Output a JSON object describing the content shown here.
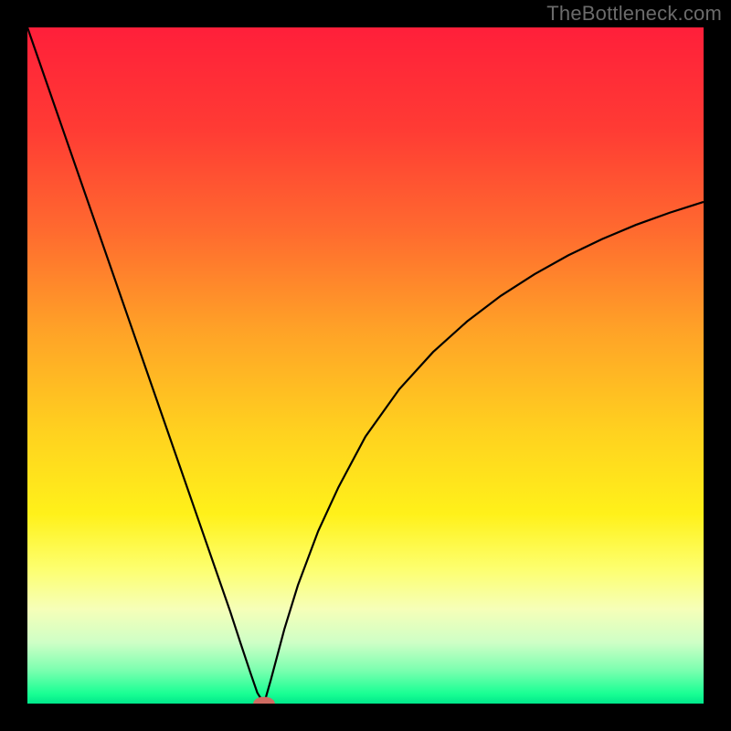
{
  "watermark": "TheBottleneck.com",
  "chart_data": {
    "type": "line",
    "title": "",
    "xlabel": "",
    "ylabel": "",
    "xlim": [
      0,
      100
    ],
    "ylim": [
      0,
      100
    ],
    "background_gradient": {
      "stops": [
        {
          "offset": 0.0,
          "color": "#ff1f3a"
        },
        {
          "offset": 0.15,
          "color": "#ff3b34"
        },
        {
          "offset": 0.3,
          "color": "#ff6a2f"
        },
        {
          "offset": 0.45,
          "color": "#ffa327"
        },
        {
          "offset": 0.6,
          "color": "#ffd21f"
        },
        {
          "offset": 0.72,
          "color": "#fff11a"
        },
        {
          "offset": 0.8,
          "color": "#fdff6e"
        },
        {
          "offset": 0.86,
          "color": "#f6ffb8"
        },
        {
          "offset": 0.91,
          "color": "#ceffc6"
        },
        {
          "offset": 0.95,
          "color": "#7dffb0"
        },
        {
          "offset": 0.985,
          "color": "#1aff94"
        },
        {
          "offset": 1.0,
          "color": "#00e88b"
        }
      ]
    },
    "series": [
      {
        "name": "bottleneck-curve",
        "color": "#000000",
        "stroke_width": 2.2,
        "x": [
          0.0,
          2.5,
          5.0,
          7.5,
          10.0,
          12.5,
          15.0,
          17.5,
          20.0,
          22.5,
          25.0,
          27.5,
          30.0,
          31.5,
          33.0,
          34.0,
          35.0,
          36.0,
          38.0,
          40.0,
          43.0,
          46.0,
          50.0,
          55.0,
          60.0,
          65.0,
          70.0,
          75.0,
          80.0,
          85.0,
          90.0,
          95.0,
          100.0
        ],
        "y": [
          100.0,
          92.8,
          85.6,
          78.4,
          71.2,
          64.0,
          56.8,
          49.6,
          42.4,
          35.2,
          28.0,
          20.8,
          13.6,
          9.0,
          4.5,
          1.6,
          0.0,
          3.5,
          11.0,
          17.5,
          25.5,
          32.0,
          39.5,
          46.5,
          52.0,
          56.5,
          60.3,
          63.5,
          66.3,
          68.7,
          70.8,
          72.6,
          74.2
        ]
      }
    ],
    "marker": {
      "name": "optimal-point",
      "x": 35.0,
      "y": 0.0,
      "rx": 1.6,
      "ry": 1.0,
      "color": "#cf6b62"
    }
  }
}
